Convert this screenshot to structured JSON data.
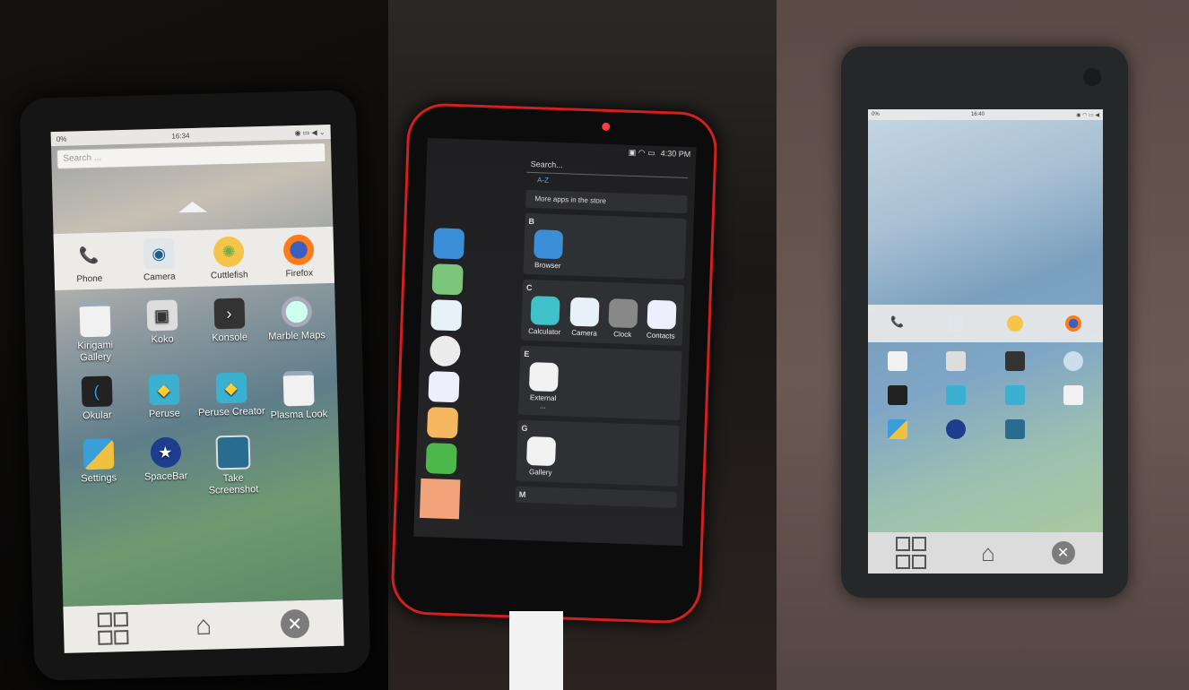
{
  "phone1": {
    "status_left": "0%",
    "status_time": "16:34",
    "search_placeholder": "Search ...",
    "favorites": [
      {
        "label": "Phone",
        "icon": "phone-icon"
      },
      {
        "label": "Camera",
        "icon": "camera-icon"
      },
      {
        "label": "Cuttlefish",
        "icon": "cuttlefish-icon"
      },
      {
        "label": "Firefox",
        "icon": "firefox-icon"
      }
    ],
    "apps": [
      {
        "label": "Kirigami Gallery"
      },
      {
        "label": "Koko"
      },
      {
        "label": "Konsole"
      },
      {
        "label": "Marble Maps"
      },
      {
        "label": "Okular"
      },
      {
        "label": "Peruse"
      },
      {
        "label": "Peruse Creator"
      },
      {
        "label": "Plasma Look"
      },
      {
        "label": "Settings"
      },
      {
        "label": "SpaceBar"
      },
      {
        "label": "Take Screenshot"
      }
    ]
  },
  "phone2": {
    "status_time": "4:30 PM",
    "search_placeholder": "Search...",
    "az_label": "A-Z",
    "store_label": "More apps in the store",
    "sections": [
      {
        "letter": "B",
        "apps": [
          "Browser"
        ]
      },
      {
        "letter": "C",
        "apps": [
          "Calculator",
          "Camera",
          "Clock",
          "Contacts"
        ]
      },
      {
        "letter": "E",
        "apps": [
          "External ..."
        ]
      },
      {
        "letter": "G",
        "apps": [
          "Gallery"
        ]
      },
      {
        "letter": "M",
        "apps": []
      }
    ]
  },
  "phone3": {
    "status_left": "0%",
    "status_time": "16:40"
  },
  "colors": {
    "accent_red": "#d21f1f",
    "ubuntu_blue": "#4fb1e6",
    "firefox_orange": "#ff7a18"
  }
}
